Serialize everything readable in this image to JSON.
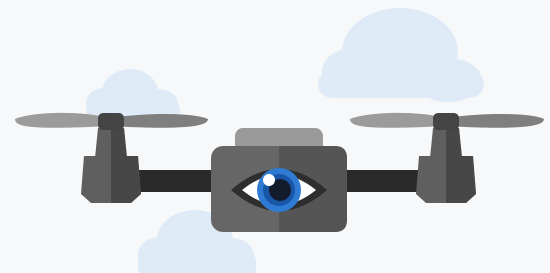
{
  "colors": {
    "background": "#f7f8fa",
    "cloud": "#deebf7",
    "drone_body_light": "#666666",
    "drone_body_dark": "#555555",
    "drone_top": "#9a9a9a",
    "arm": "#2a2a2a",
    "motor_light": "#5f5f5f",
    "motor_dark": "#474747",
    "propeller_light": "#9b9b9b",
    "propeller_dark": "#7f7f7f",
    "hub": "#444444",
    "lens_housing": "#2e2e2e",
    "sclera": "#ffffff",
    "iris_outer": "#2f7bd4",
    "iris_inner": "#1856a8",
    "pupil": "#141b2c",
    "highlight": "#ffffff"
  },
  "icons": [
    "cloud-icon",
    "drone-icon",
    "propeller-icon",
    "motor-icon",
    "camera-body-icon",
    "eye-icon"
  ]
}
